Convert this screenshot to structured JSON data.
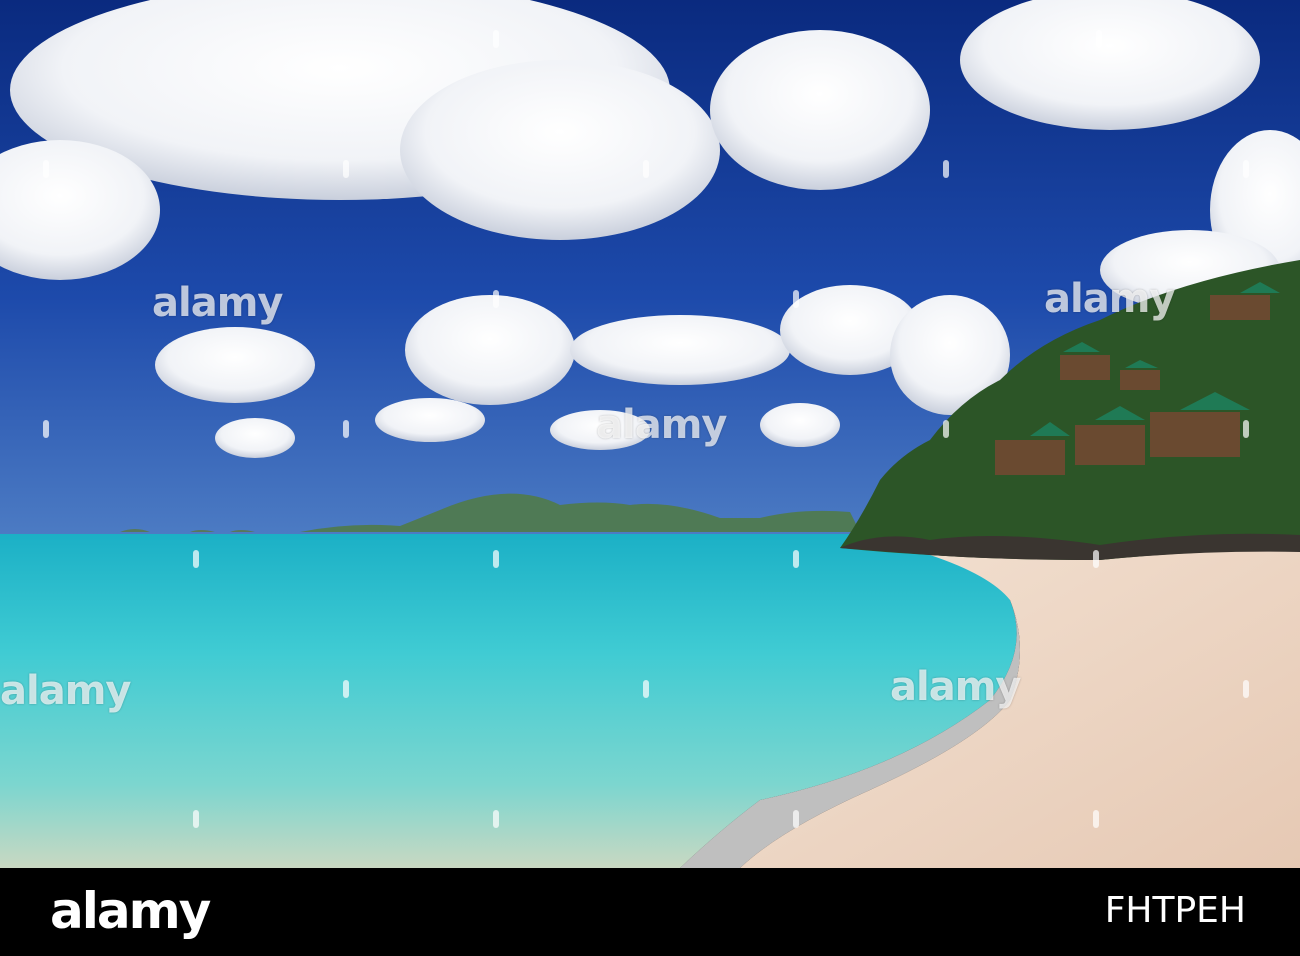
{
  "photo": {
    "alt_icon": "beach-photo-icon",
    "colors": {
      "sky_top": "#0b2f8a",
      "sky_mid": "#1e4fb3",
      "sea_turquoise": "#3ec9d1",
      "sea_deep": "#1aa6b8",
      "sand": "#efd9c6",
      "foliage": "#2f5a2a"
    }
  },
  "watermark": {
    "text": "alamy"
  },
  "footer": {
    "logo": "alamy",
    "image_id": "FHTPEH"
  }
}
